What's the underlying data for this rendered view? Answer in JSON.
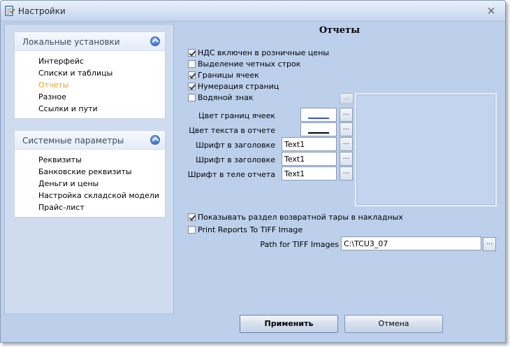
{
  "window": {
    "title": "Настройки",
    "close_glyph": "×",
    "icon": "settings-doc-icon"
  },
  "left_panel": {
    "local": {
      "title": "Локальные установки",
      "items": [
        "Интерфейс",
        "Списки и таблицы",
        "Отчеты",
        "Разное",
        "Ссылки и пути"
      ],
      "active_index": 2
    },
    "system": {
      "title": "Системные параметры",
      "items": [
        "Реквизиты",
        "Банковские реквизиты",
        "Деньги и цены",
        "Настройка складской модели",
        "Прайс-лист"
      ]
    }
  },
  "reports": {
    "title": "Отчеты",
    "checkboxes": [
      {
        "label": "НДС включен в розничные цены",
        "checked": true
      },
      {
        "label": "Выделение четных строк",
        "checked": false
      },
      {
        "label": "Границы ячеек",
        "checked": true
      },
      {
        "label": "Нумерация страниц",
        "checked": true
      },
      {
        "label": "Водяной знак",
        "checked": false
      }
    ],
    "fields": {
      "cell_border_color": {
        "label": "Цвет границ ячеек",
        "color": "#3355cc"
      },
      "report_text_color": {
        "label": "Цвет текста в отчете",
        "color": "#000000"
      },
      "header_font_1": {
        "label": "Шрифт в заголовке",
        "value": "Text1"
      },
      "header_font_2": {
        "label": "Шрифт в заголовке",
        "value": "Text1"
      },
      "body_font": {
        "label": "Шрифт в теле отчета",
        "value": "Text1"
      }
    },
    "dots_label": "...",
    "return_tare": {
      "label": "Показывать раздел возвратной тары в накладных",
      "checked": true
    },
    "tiff": {
      "label": "Print Reports To TIFF Image",
      "checked": false
    },
    "tiff_path": {
      "label": "Path for TIFF Images",
      "value": "C:\\TCU3_07"
    }
  },
  "buttons": {
    "apply": "Применить",
    "cancel": "Отмена"
  }
}
